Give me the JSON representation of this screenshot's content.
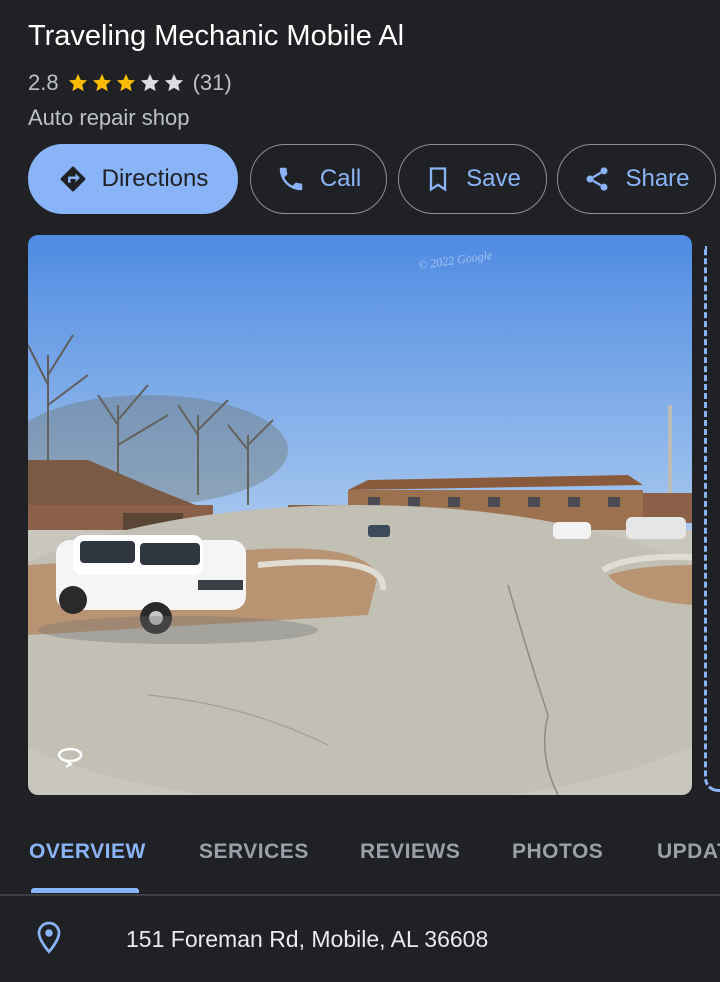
{
  "place": {
    "name": "Traveling Mechanic Mobile Al",
    "rating": "2.8",
    "rating_value": 2.8,
    "stars_filled": 3,
    "stars_total": 5,
    "review_count": "(31)",
    "category": "Auto repair shop"
  },
  "actions": {
    "directions": "Directions",
    "call": "Call",
    "save": "Save",
    "share": "Share"
  },
  "photo": {
    "watermark": "© 2022 Google"
  },
  "tabs": [
    {
      "label": "OVERVIEW",
      "active": true
    },
    {
      "label": "SERVICES",
      "active": false
    },
    {
      "label": "REVIEWS",
      "active": false
    },
    {
      "label": "PHOTOS",
      "active": false
    },
    {
      "label": "UPDAT",
      "active": false
    }
  ],
  "address": "151 Foreman Rd, Mobile, AL 36608",
  "colors": {
    "background": "#202124",
    "accent": "#8ab4f8",
    "star": "#fbbc04",
    "star_empty": "#dadce0"
  },
  "icons": {
    "directions": "directions-icon",
    "call": "phone-icon",
    "save": "bookmark-icon",
    "share": "share-icon",
    "address": "location-pin-icon",
    "photo_overlay": "360-rotate-icon"
  }
}
